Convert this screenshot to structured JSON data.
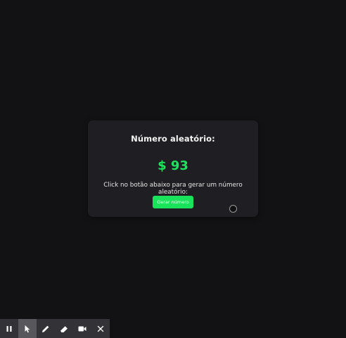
{
  "card": {
    "title": "Número aleatório:",
    "value": "$ 93",
    "description": "Click no botão abaixo para gerar um número aleatório:",
    "button_label": "Gerar número"
  },
  "colors": {
    "background": "#121113",
    "card": "#1f1e22",
    "accent": "#1ee35f",
    "toolbar": "#333236",
    "toolbar_active": "#58585c"
  },
  "toolbar": {
    "tools": [
      {
        "icon": "pause-icon",
        "active": false
      },
      {
        "icon": "pointer-icon",
        "active": true
      },
      {
        "icon": "pencil-icon",
        "active": false
      },
      {
        "icon": "eraser-icon",
        "active": false
      },
      {
        "icon": "video-camera-icon",
        "active": false
      },
      {
        "icon": "close-icon",
        "active": false
      }
    ]
  }
}
